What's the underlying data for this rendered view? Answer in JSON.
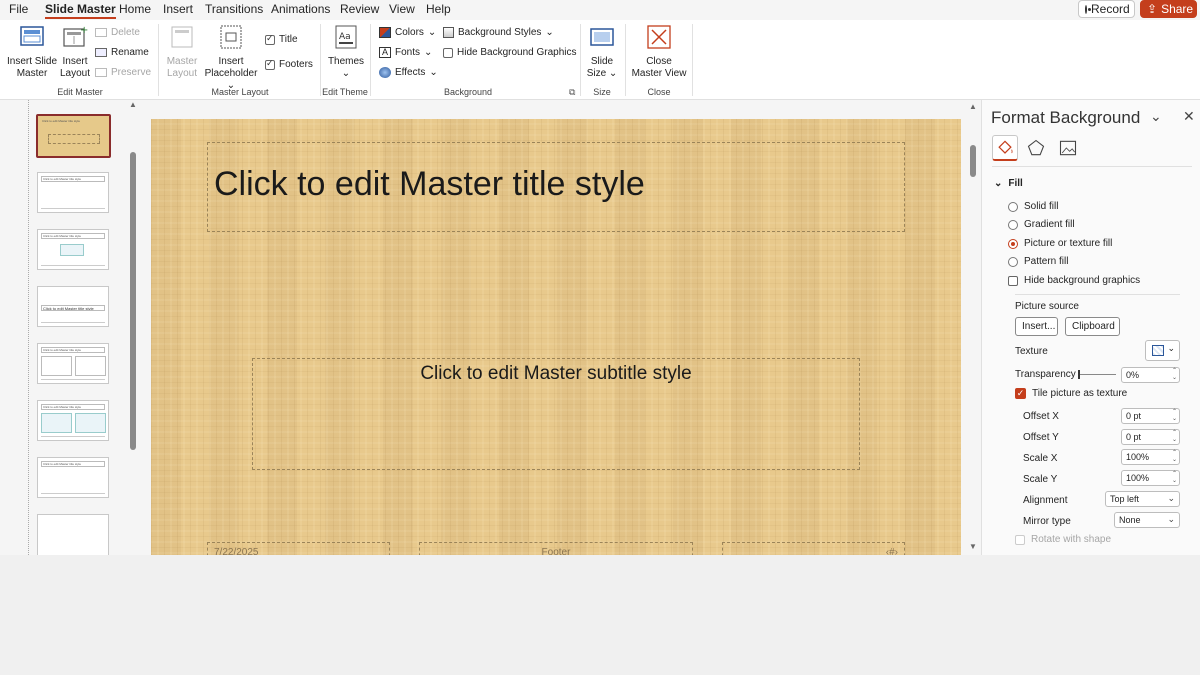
{
  "menubar": {
    "tabs": [
      "File",
      "Slide Master",
      "Home",
      "Insert",
      "Transitions",
      "Animations",
      "Review",
      "View",
      "Help"
    ],
    "active_tab": "Slide Master",
    "record_label": "Record",
    "share_label": "Share"
  },
  "ribbon": {
    "edit_master": {
      "insert_slide_master": "Insert Slide Master",
      "insert_slide_master_l1": "Insert Slide",
      "insert_slide_master_l2": "Master",
      "insert_layout_l1": "Insert",
      "insert_layout_l2": "Layout",
      "delete": "Delete",
      "rename": "Rename",
      "preserve": "Preserve",
      "group": "Edit Master"
    },
    "master_layout": {
      "master_layout_l1": "Master",
      "master_layout_l2": "Layout",
      "insert_placeholder_l1": "Insert",
      "insert_placeholder_l2": "Placeholder",
      "title": "Title",
      "footers": "Footers",
      "group": "Master Layout"
    },
    "edit_theme": {
      "themes": "Themes",
      "group": "Edit Theme"
    },
    "background": {
      "colors": "Colors",
      "fonts": "Fonts",
      "effects": "Effects",
      "background_styles": "Background Styles",
      "hide_background_graphics": "Hide Background Graphics",
      "group": "Background"
    },
    "size": {
      "slide_size_l1": "Slide",
      "slide_size_l2": "Size",
      "group": "Size"
    },
    "close": {
      "close_l1": "Close",
      "close_l2": "Master View",
      "group": "Close"
    }
  },
  "thumbnails": {
    "master_title": "Click to edit Master title style",
    "layout_title": "Click to edit Master title style"
  },
  "slide": {
    "title": "Click to edit Master title style",
    "subtitle": "Click to edit Master subtitle style",
    "date": "7/22/2025",
    "footer": "Footer",
    "page_number": "‹#›"
  },
  "format_pane": {
    "title": "Format Background",
    "fill_section": "Fill",
    "solid_fill": "Solid fill",
    "gradient_fill": "Gradient fill",
    "picture_fill": "Picture or texture fill",
    "pattern_fill": "Pattern fill",
    "hide_bg_graphics": "Hide background graphics",
    "picture_source": "Picture source",
    "insert_btn": "Insert...",
    "clipboard_btn": "Clipboard",
    "texture": "Texture",
    "transparency": "Transparency",
    "transparency_value": "0%",
    "tile": "Tile picture as texture",
    "offset_x": "Offset X",
    "offset_x_value": "0 pt",
    "offset_y": "Offset Y",
    "offset_y_value": "0 pt",
    "scale_x": "Scale X",
    "scale_x_value": "100%",
    "scale_y": "Scale Y",
    "scale_y_value": "100%",
    "alignment": "Alignment",
    "alignment_value": "Top left",
    "mirror_type": "Mirror type",
    "mirror_value": "None",
    "rotate_with_shape": "Rotate with shape"
  }
}
